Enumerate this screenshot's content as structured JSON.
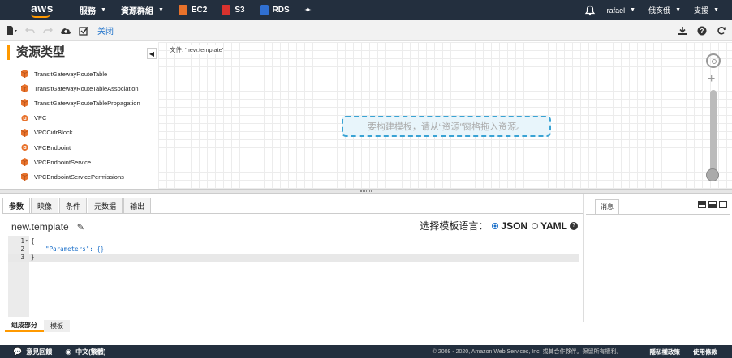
{
  "nav": {
    "brand": "aws",
    "services": "服務",
    "resource_groups": "資源群組",
    "shortcuts": [
      {
        "label": "EC2",
        "color": "#e8722b"
      },
      {
        "label": "S3",
        "color": "#d9322e"
      },
      {
        "label": "RDS",
        "color": "#2f6fd1"
      }
    ],
    "user": "rafael",
    "region": "俄亥俄",
    "support": "支援"
  },
  "toolbar": {
    "close_label": "关闭"
  },
  "resources": {
    "title": "资源类型",
    "items": [
      {
        "label": "TransitGatewayRouteTable",
        "icon": "cube-icon"
      },
      {
        "label": "TransitGatewayRouteTableAssociation",
        "icon": "cube-icon"
      },
      {
        "label": "TransitGatewayRouteTablePropagation",
        "icon": "cube-icon"
      },
      {
        "label": "VPC",
        "icon": "vpc-icon"
      },
      {
        "label": "VPCCidrBlock",
        "icon": "cube-icon"
      },
      {
        "label": "VPCEndpoint",
        "icon": "vpc-icon"
      },
      {
        "label": "VPCEndpointService",
        "icon": "cube-icon"
      },
      {
        "label": "VPCEndpointServicePermissions",
        "icon": "cube-icon"
      }
    ]
  },
  "canvas": {
    "file_label": "文件: 'new.template'",
    "drop_hint": "要构建模板，请从“资源”窗格拖入资源。"
  },
  "editor": {
    "tabs": [
      "参数",
      "映像",
      "条件",
      "元数据",
      "输出"
    ],
    "active_tab": "参数",
    "template_name": "new.template",
    "lang_prompt": "选择模板语言：",
    "lang_json": "JSON",
    "lang_yaml": "YAML",
    "selected_lang": "JSON",
    "code_lines": [
      {
        "num": "1",
        "text": "{"
      },
      {
        "num": "2",
        "text": "    \"Parameters\": {}"
      },
      {
        "num": "3",
        "text": "}"
      }
    ],
    "bottom_tabs": [
      "组成部分",
      "模板"
    ]
  },
  "messages": {
    "tab_label": "消息"
  },
  "footer": {
    "feedback": "意見回饋",
    "language": "中文(繁體)",
    "copyright": "© 2008 - 2020, Amazon Web Services, Inc. 或其合作夥伴。保留所有權利。",
    "privacy": "隱私權政策",
    "terms": "使用條款"
  },
  "colors": {
    "nav_bg": "#232f3e",
    "accent": "#ff9900",
    "link": "#1a6fc9",
    "resource_icon": "#e8722b"
  }
}
